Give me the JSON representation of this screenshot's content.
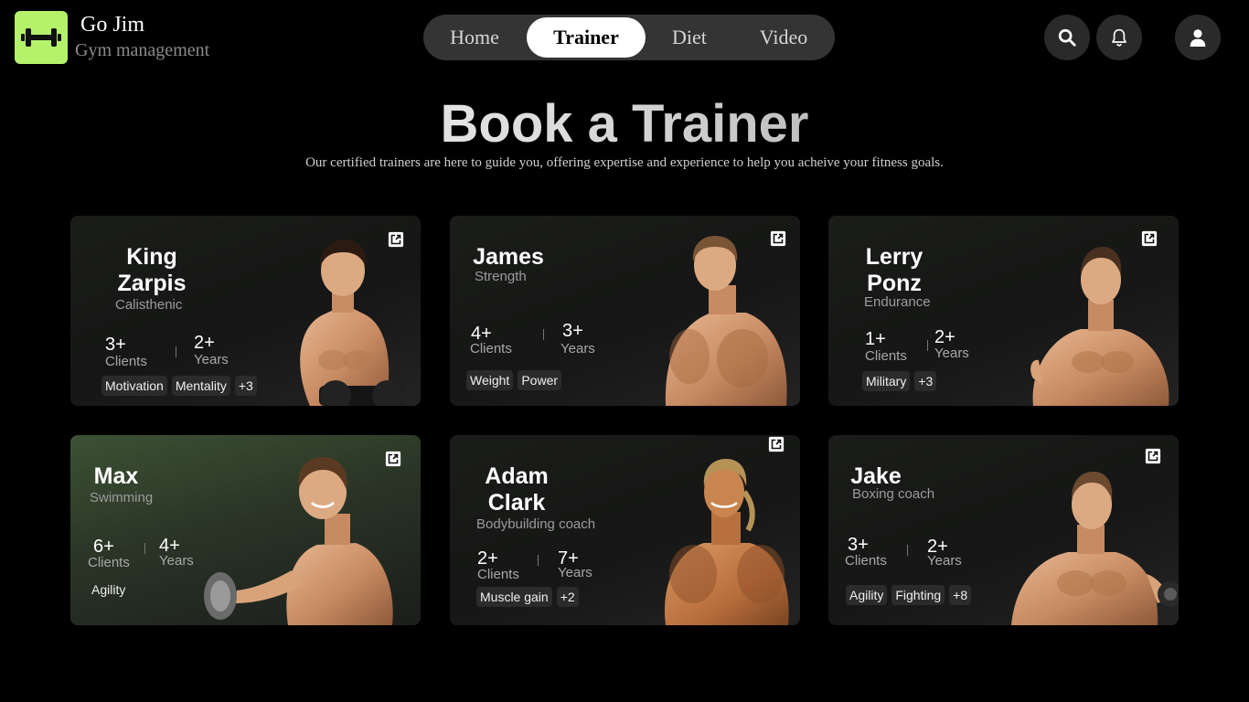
{
  "app": {
    "title": "Go Jim",
    "subtitle": "Gym management",
    "logo_icon": "dumbbell-icon",
    "accent_color": "#b3f26a"
  },
  "nav": {
    "tabs": [
      {
        "label": "Home",
        "active": false
      },
      {
        "label": "Trainer",
        "active": true
      },
      {
        "label": "Diet",
        "active": false
      },
      {
        "label": "Video",
        "active": false
      }
    ]
  },
  "header_icons": [
    "search-icon",
    "bell-icon",
    "user-icon"
  ],
  "hero": {
    "title": "Book a Trainer",
    "subtitle": "Our certified trainers are here to guide you, offering expertise and experience to help you acheive your fitness goals."
  },
  "trainers": [
    {
      "first": "King",
      "last": "Zarpis",
      "specialty": "Calisthenic",
      "clients": "3+",
      "clients_label": "Clients",
      "years": "2+",
      "years_label": "Years",
      "tags": [
        "Motivation",
        "Mentality",
        "+3"
      ]
    },
    {
      "first": "James",
      "last": "",
      "specialty": "Strength",
      "clients": "4+",
      "clients_label": "Clients",
      "years": "3+",
      "years_label": "Years",
      "tags": [
        "Weight",
        "Power"
      ]
    },
    {
      "first": "Lerry",
      "last": "Ponz",
      "specialty": "Endurance",
      "clients": "1+",
      "clients_label": "Clients",
      "years": "2+",
      "years_label": "Years",
      "tags": [
        "Military",
        "+3"
      ]
    },
    {
      "first": "Max",
      "last": "",
      "specialty": "Swimming",
      "clients": "6+",
      "clients_label": "Clients",
      "years": "4+",
      "years_label": "Years",
      "tags": [
        "Agility"
      ]
    },
    {
      "first": "Adam",
      "last": "Clark",
      "specialty": "Bodybuilding coach",
      "clients": "2+",
      "clients_label": "Clients",
      "years": "7+",
      "years_label": "Years",
      "tags": [
        "Muscle gain",
        "+2"
      ]
    },
    {
      "first": "Jake",
      "last": "",
      "specialty": "Boxing coach",
      "clients": "3+",
      "clients_label": "Clients",
      "years": "2+",
      "years_label": "Years",
      "tags": [
        "Agility",
        "Fighting",
        "+8"
      ]
    }
  ]
}
